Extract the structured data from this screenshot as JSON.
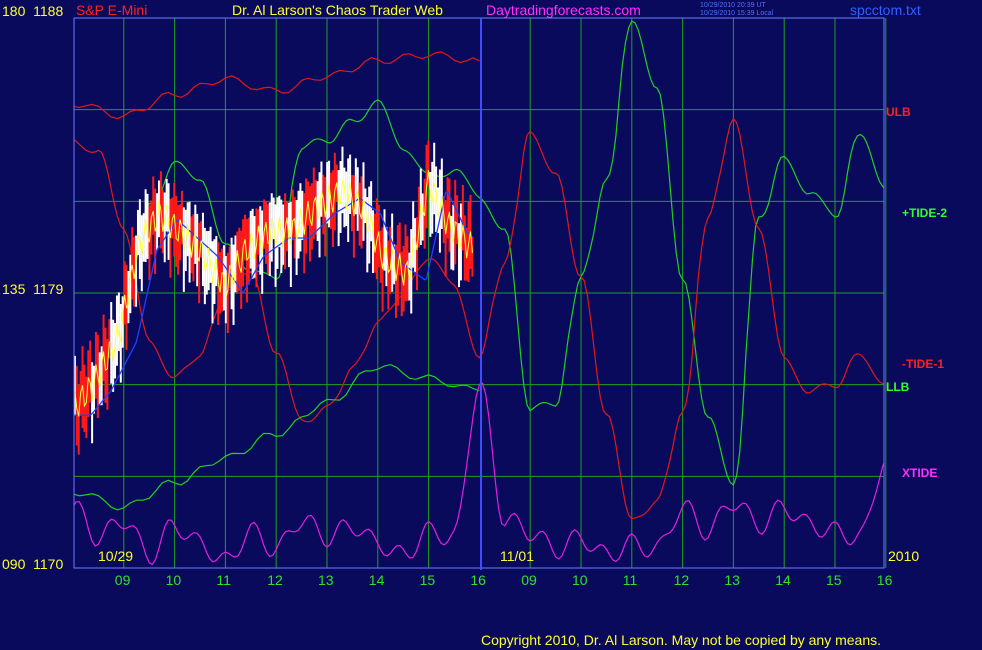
{
  "header": {
    "symbol": "S&P E-Mini",
    "title": "Dr. Al Larson's Chaos Trader Web",
    "site": "Daytradingforecasts.com",
    "timestamp_ut": "10/29/2010 20:39 UT",
    "timestamp_local": "10/29/2010 15:39 Local",
    "file": "spcctom.txt"
  },
  "y_axis_labels": [
    {
      "osc": "180",
      "price": "1188"
    },
    {
      "osc": "135",
      "price": "1179"
    },
    {
      "osc": "090",
      "price": "1170"
    }
  ],
  "right_labels": [
    {
      "text": "ULB",
      "color": "#ff2020"
    },
    {
      "text": "+TIDE-2",
      "color": "#30ff30"
    },
    {
      "text": "-TIDE-1",
      "color": "#ff2020"
    },
    {
      "text": "LLB",
      "color": "#30ff30"
    },
    {
      "text": "XTIDE",
      "color": "#ff30ff"
    }
  ],
  "date_labels": [
    "10/29",
    "11/01",
    "2010"
  ],
  "footer": "Copyright 2010, Dr. Al Larson. May not be copied by any means.",
  "colors": {
    "background": "#0a0a5c",
    "grid": "#1fa01f",
    "ulb": "#e01818",
    "tide_plus": "#20d020",
    "tide_minus": "#e01818",
    "llb": "#20d020",
    "xtide": "#e020e0",
    "ma_yellow": "#ffff40",
    "ma_blue": "#2040ff",
    "candle_up": "#ffffff",
    "candle_down": "#ff1a1a"
  },
  "chart_data": {
    "type": "line",
    "y_scale_price": [
      1170,
      1188
    ],
    "y_scale_osc": [
      90,
      180
    ],
    "x_ticks": [
      "09",
      "10",
      "11",
      "12",
      "13",
      "14",
      "15",
      "16",
      "09",
      "10",
      "11",
      "12",
      "13",
      "14",
      "15",
      "16"
    ],
    "series": [
      {
        "name": "ULB",
        "x": [
          0,
          1,
          2,
          3,
          4,
          5,
          6,
          7,
          8
        ],
        "values": [
          1185.2,
          1184.8,
          1185.5,
          1186.0,
          1185.6,
          1186.1,
          1186.6,
          1186.8,
          1186.6
        ]
      },
      {
        "name": "+TIDE-2",
        "x": [
          0,
          0.5,
          1,
          1.5,
          2,
          2.5,
          3,
          3.5,
          4,
          4.5,
          5,
          5.5,
          6,
          6.5,
          7,
          7.5,
          8,
          8.5,
          9,
          9.5,
          10,
          10.5,
          11,
          11.5,
          12,
          12.5,
          13,
          13.5,
          14,
          14.5,
          15,
          15.5,
          16
        ],
        "values": [
          1175.2,
          1176.6,
          1178.5,
          1181.8,
          1183.2,
          1182.8,
          1180.5,
          1179.8,
          1179.4,
          1183.8,
          1184.0,
          1184.6,
          1185.2,
          1183.8,
          1182.8,
          1183.0,
          1182.2,
          1181.0,
          1175.2,
          1175.4,
          1179.5,
          1182.6,
          1188.0,
          1185.6,
          1179.5,
          1175.0,
          1172.6,
          1181.4,
          1183.4,
          1182.3,
          1181.5,
          1184.3,
          1182.4
        ]
      },
      {
        "name": "-TIDE-1",
        "x": [
          0,
          0.5,
          1,
          1.5,
          2,
          2.5,
          3,
          3.5,
          4,
          4.5,
          5,
          5.5,
          6,
          6.5,
          7,
          7.5,
          8,
          8.5,
          9,
          9.5,
          10,
          10.5,
          11,
          11.5,
          12,
          12.5,
          13,
          13.5,
          14,
          14.5,
          15,
          15.5,
          16
        ],
        "values": [
          1184.0,
          1183.6,
          1181.0,
          1177.5,
          1176.2,
          1177.0,
          1179.0,
          1179.8,
          1177.0,
          1174.8,
          1175.2,
          1176.5,
          1178.0,
          1179.0,
          1180.2,
          1179.2,
          1177.0,
          1180.0,
          1184.2,
          1183.0,
          1179.5,
          1175.0,
          1171.5,
          1172.2,
          1175.0,
          1181.5,
          1184.6,
          1181.0,
          1176.8,
          1175.8,
          1176.0,
          1177.0,
          1176.0
        ]
      },
      {
        "name": "LLB",
        "x": [
          0,
          1,
          2,
          3,
          4,
          5,
          6,
          7,
          8
        ],
        "values": [
          1172.5,
          1172.0,
          1172.8,
          1173.6,
          1174.4,
          1175.4,
          1176.6,
          1176.2,
          1175.8
        ]
      },
      {
        "name": "XTIDE",
        "x": [
          0,
          0.5,
          1,
          1.5,
          2,
          2.5,
          3,
          3.5,
          4,
          4.5,
          5,
          5.5,
          6,
          6.5,
          7,
          7.5,
          8,
          8.5,
          9,
          9.5,
          10,
          10.5,
          11,
          11.5,
          12,
          12.5,
          13,
          13.5,
          14,
          14.5,
          15,
          15.5,
          16
        ],
        "values": [
          100,
          95,
          98,
          92,
          97,
          94,
          91,
          96,
          93,
          98,
          95,
          97,
          94,
          92,
          96,
          95,
          120,
          98,
          96,
          93,
          95,
          92,
          94,
          93,
          100,
          96,
          101,
          97,
          100,
          97,
          96,
          95,
          108
        ]
      }
    ],
    "annotations": [
      {
        "text": "ULB",
        "value": 1186.6
      },
      {
        "text": "+TIDE-2",
        "value": 1183.5
      },
      {
        "text": "-TIDE-1",
        "value": 1177.3
      },
      {
        "text": "LLB",
        "value": 1176.0
      },
      {
        "text": "XTIDE",
        "value": 172.0
      }
    ],
    "grid": true
  }
}
